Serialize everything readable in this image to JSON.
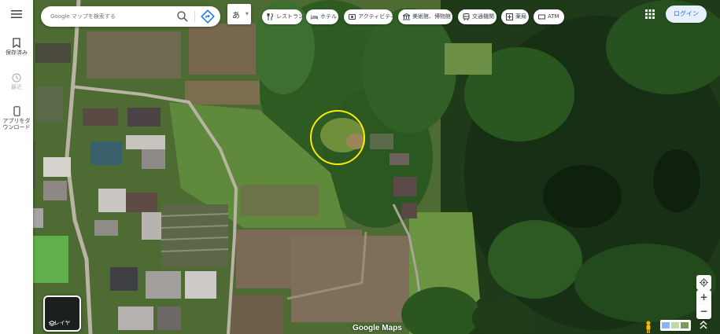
{
  "search": {
    "placeholder": "Google マップを検索する",
    "search_icon": "search-icon",
    "directions_icon": "directions-icon"
  },
  "ime": {
    "label": "あ"
  },
  "left_rail": {
    "menu_icon": "hamburger-menu-icon",
    "items": [
      {
        "label": "保存済み",
        "icon": "bookmark-icon"
      },
      {
        "label": "最近",
        "icon": "history-icon"
      },
      {
        "label": "アプリをダウンロード",
        "icon": "phone-icon"
      }
    ]
  },
  "chips": [
    {
      "label": "レストラン",
      "icon": "restaurant-icon"
    },
    {
      "label": "ホテル",
      "icon": "hotel-icon"
    },
    {
      "label": "アクティビティ",
      "icon": "activity-icon"
    },
    {
      "label": "美術館、博物館",
      "icon": "museum-icon"
    },
    {
      "label": "交通機関",
      "icon": "transit-icon"
    },
    {
      "label": "薬局",
      "icon": "pharmacy-icon"
    },
    {
      "label": "ATM",
      "icon": "atm-icon"
    }
  ],
  "header": {
    "apps_icon": "apps-grid-icon",
    "signin_label": "ログイン"
  },
  "layers": {
    "label": "レイヤ",
    "icon": "layers-icon"
  },
  "controls": {
    "locate_icon": "my-location-icon",
    "zoom_in": "+",
    "zoom_out": "−",
    "pegman_icon": "pegman-icon",
    "expand_icon": "expand-icon"
  },
  "attribution": "Google Maps",
  "colors": {
    "highlight": "#ffeb00",
    "accent": "#1a73e8",
    "signin_bg": "#e8f0fe"
  }
}
